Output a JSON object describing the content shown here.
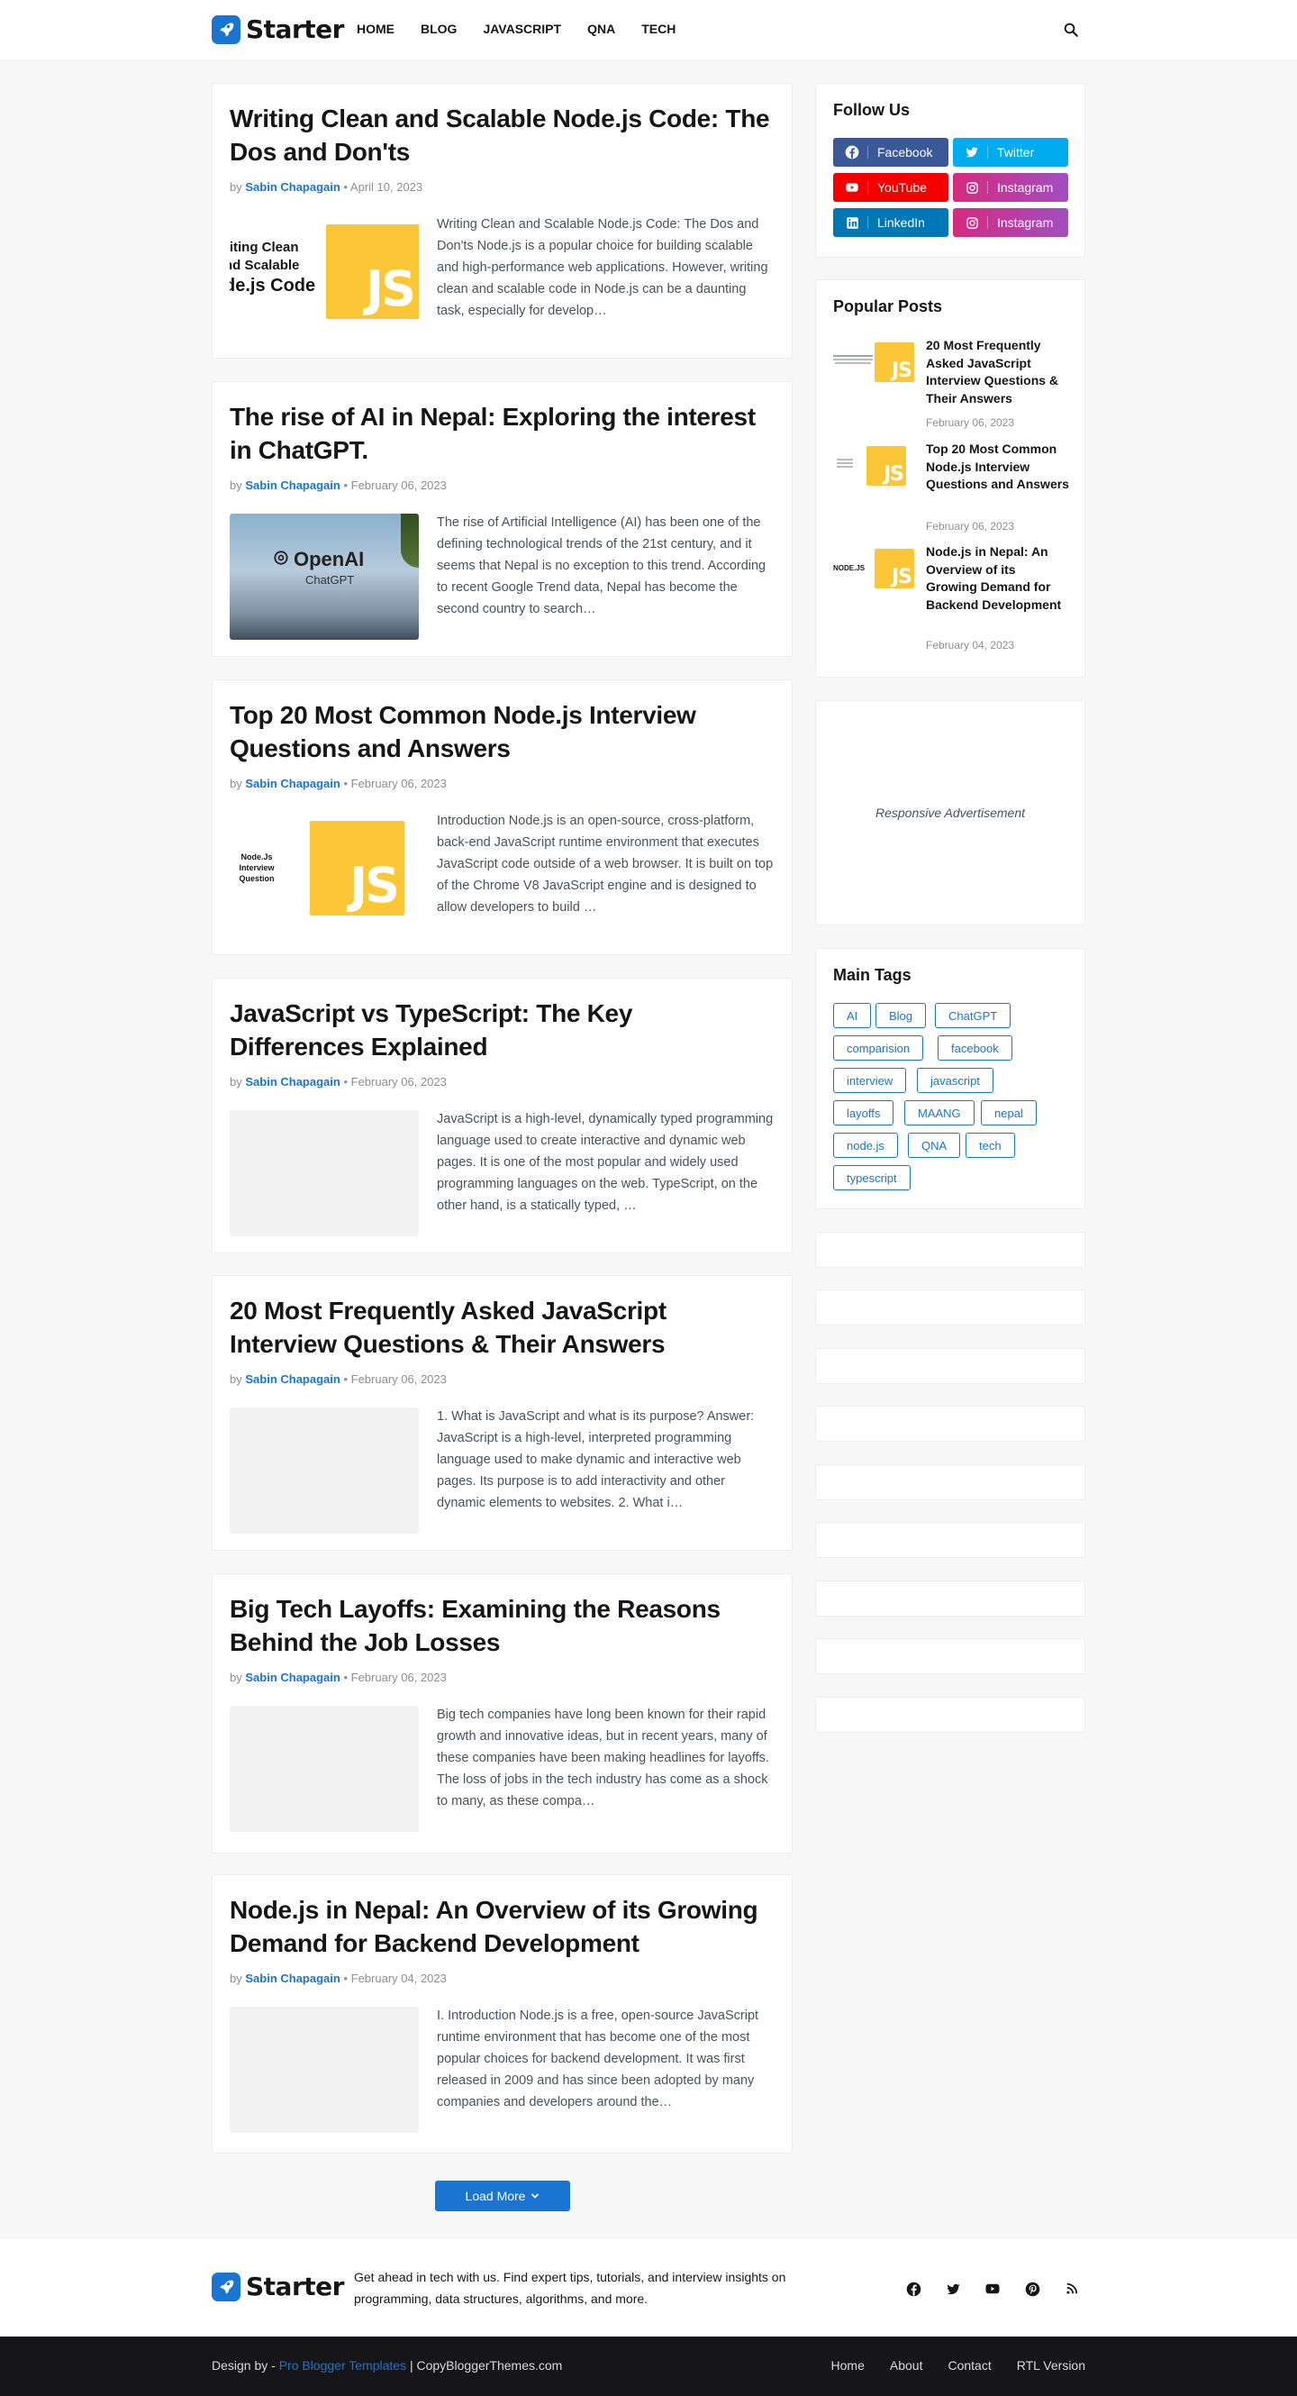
{
  "header": {
    "logo": "Starter",
    "nav": [
      "HOME",
      "BLOG",
      "JAVASCRIPT",
      "QNA",
      "TECH"
    ]
  },
  "posts": [
    {
      "title": "Writing Clean and Scalable Node.js Code: The Dos and Don'ts",
      "author": "Sabin Chapagain",
      "date": "April 10, 2023",
      "snippet": "Writing Clean and Scalable Node.js Code: The Dos and Don'ts Node.js is a popular choice for building scalable and high-performance web applications. However, writing clean and scalable code in Node.js can be a daunting task, especially for develop…",
      "thumb_text": [
        "riting Clean",
        "nd Scalable",
        "de.js Code"
      ]
    },
    {
      "title": "The rise of AI in Nepal: Exploring the interest in ChatGPT.",
      "author": "Sabin Chapagain",
      "date": "February 06, 2023",
      "snippet": "The rise of Artificial Intelligence (AI) has been one of the defining technological trends of the 21st century, and it seems that Nepal is no exception to this trend. According to recent Google Trend data, Nepal has become the second country to search…",
      "thumb_text": [
        "OpenAI",
        "ChatGPT"
      ]
    },
    {
      "title": "Top 20 Most Common Node.js Interview Questions and Answers",
      "author": "Sabin Chapagain",
      "date": "February 06, 2023",
      "snippet": "Introduction Node.js is an open-source, cross-platform, back-end JavaScript runtime environment that executes JavaScript code outside of a web browser. It is built on top of the Chrome V8 JavaScript engine and is designed to allow developers to build …",
      "thumb_text": [
        "Node.Js",
        "Interview",
        "Question"
      ]
    },
    {
      "title": "JavaScript vs TypeScript: The Key Differences Explained",
      "author": "Sabin Chapagain",
      "date": "February 06, 2023",
      "snippet": "JavaScript is a high-level, dynamically typed programming language used to create interactive and dynamic web pages. It is one of the most popular and widely used programming languages on the web. TypeScript, on the other hand, is a statically typed, …"
    },
    {
      "title": "20 Most Frequently Asked JavaScript Interview Questions & Their Answers",
      "author": "Sabin Chapagain",
      "date": "February 06, 2023",
      "snippet": "1. What is JavaScript and what is its purpose? Answer: JavaScript is a high-level, interpreted programming language used to make dynamic and interactive web pages. Its purpose is to add interactivity and other dynamic elements to websites. 2. What i…"
    },
    {
      "title": "Big Tech Layoffs: Examining the Reasons Behind the Job Losses",
      "author": "Sabin Chapagain",
      "date": "February 06, 2023",
      "snippet": "Big tech companies have long been known for their rapid growth and innovative ideas, but in recent years, many of these companies have been making headlines for layoffs. The loss of jobs in the tech industry has come as a shock to many, as these compa…"
    },
    {
      "title": "Node.js in Nepal: An Overview of its Growing Demand for Backend Development",
      "author": "Sabin Chapagain",
      "date": "February 04, 2023",
      "snippet": "I. Introduction Node.js is a free, open-source JavaScript runtime environment that has become one of the most popular choices for backend development. It was first released in 2009 and has since been adopted by many companies and developers around the…"
    }
  ],
  "meta_by": "by",
  "meta_sep": "•",
  "js_label": "JS",
  "load_more": "Load More",
  "sidebar": {
    "follow_title": "Follow Us",
    "social": [
      {
        "label": "Facebook",
        "color": "#3b5998"
      },
      {
        "label": "Twitter",
        "color": "#00acee"
      },
      {
        "label": "YouTube",
        "color": "#f50000"
      },
      {
        "label": "Instagram",
        "color": "#c13584"
      },
      {
        "label": "LinkedIn",
        "color": "#0077b5"
      },
      {
        "label": "Instagram",
        "color": "#c13584"
      }
    ],
    "popular_title": "Popular Posts",
    "popular": [
      {
        "title": "20 Most Frequently Asked JavaScript Interview Questions & Their Answers",
        "date": "February 06, 2023"
      },
      {
        "title": "Top 20 Most Common Node.js Interview Questions and Answers",
        "date": "February 06, 2023"
      },
      {
        "title": "Node.js in Nepal: An Overview of its Growing Demand for Backend Development",
        "date": "February 04, 2023",
        "thumb_text": "NODE.JS"
      }
    ],
    "ad_text": "Responsive Advertisement",
    "tags_title": "Main Tags",
    "tags": [
      "AI",
      "Blog",
      "ChatGPT",
      "comparision",
      "facebook",
      "interview",
      "javascript",
      "layoffs",
      "MAANG",
      "nepal",
      "node.js",
      "QNA",
      "tech",
      "typescript"
    ]
  },
  "footer": {
    "logo": "Starter",
    "description": "Get ahead in tech with us. Find expert tips, tutorials, and interview insights on programming, data structures, algorithms, and more.",
    "credit_prefix": "Design by -",
    "credit_link": "Pro Blogger Templates",
    "credit_suffix": "| CopyBloggerThemes.com",
    "links": [
      "Home",
      "About",
      "Contact",
      "RTL Version"
    ]
  },
  "colors": {
    "accent": "#1a74d2",
    "js_yellow": "#fbc737",
    "dark_footer": "#161619"
  }
}
